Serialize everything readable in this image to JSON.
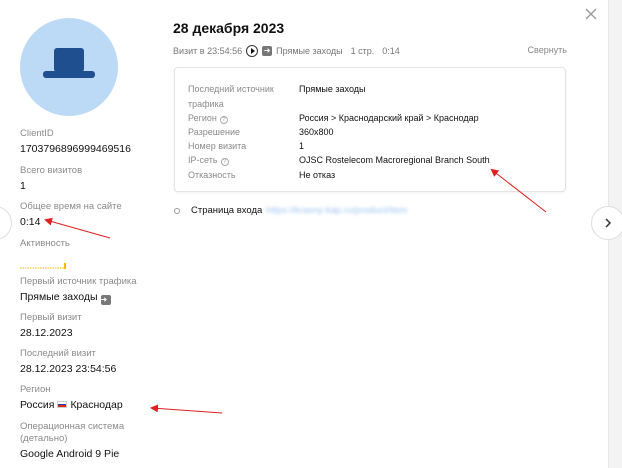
{
  "header": {
    "date": "28 декабря 2023",
    "visit_time_text": "Визит в 23:54:56",
    "source_text": "Прямые заходы",
    "pages_text": "1 стр.",
    "duration_text": "0:14",
    "collapse_label": "Свернуть"
  },
  "visit_details": [
    {
      "label": "Последний источник трафика",
      "value": "Прямые заходы",
      "help": false
    },
    {
      "label": "Регион",
      "value": "Россия > Краснодарский край > Краснодар",
      "help": true
    },
    {
      "label": "Разрешение",
      "value": "360x800",
      "help": false
    },
    {
      "label": "Номер визита",
      "value": "1",
      "help": false
    },
    {
      "label": "IP-сеть",
      "value": "OJSC Rostelecom Macroregional Branch South",
      "help": true
    },
    {
      "label": "Отказность",
      "value": "Не отказ",
      "help": false
    }
  ],
  "entry": {
    "label": "Страница входа",
    "url": "https://krasny-kap.ru/product/item"
  },
  "profile": {
    "client_id_label": "ClientID",
    "client_id": "1703796896999469516",
    "total_visits_label": "Всего визитов",
    "total_visits": "1",
    "total_time_label": "Общее время на сайте",
    "total_time": "0:14",
    "activity_label": "Активность",
    "first_source_label": "Первый источник трафика",
    "first_source": "Прямые заходы",
    "first_visit_label": "Первый визит",
    "first_visit": "28.12.2023",
    "last_visit_label": "Последний визит",
    "last_visit": "28.12.2023 23:54:56",
    "region_label": "Регион",
    "region_country": "Россия",
    "region_city": "Краснодар",
    "os_label": "Операционная система (детально)",
    "os": "Google Android 9 Pie"
  },
  "colors": {
    "avatar_bg": "#bcd9f6",
    "hat": "#1f4f8f",
    "activity": "#f5b800",
    "annotation_arrow": "#e02020"
  },
  "icons": {
    "close": "close-icon",
    "next": "chevron-right-icon",
    "play": "play-icon",
    "direct": "direct-visit-icon",
    "help": "question-icon"
  }
}
